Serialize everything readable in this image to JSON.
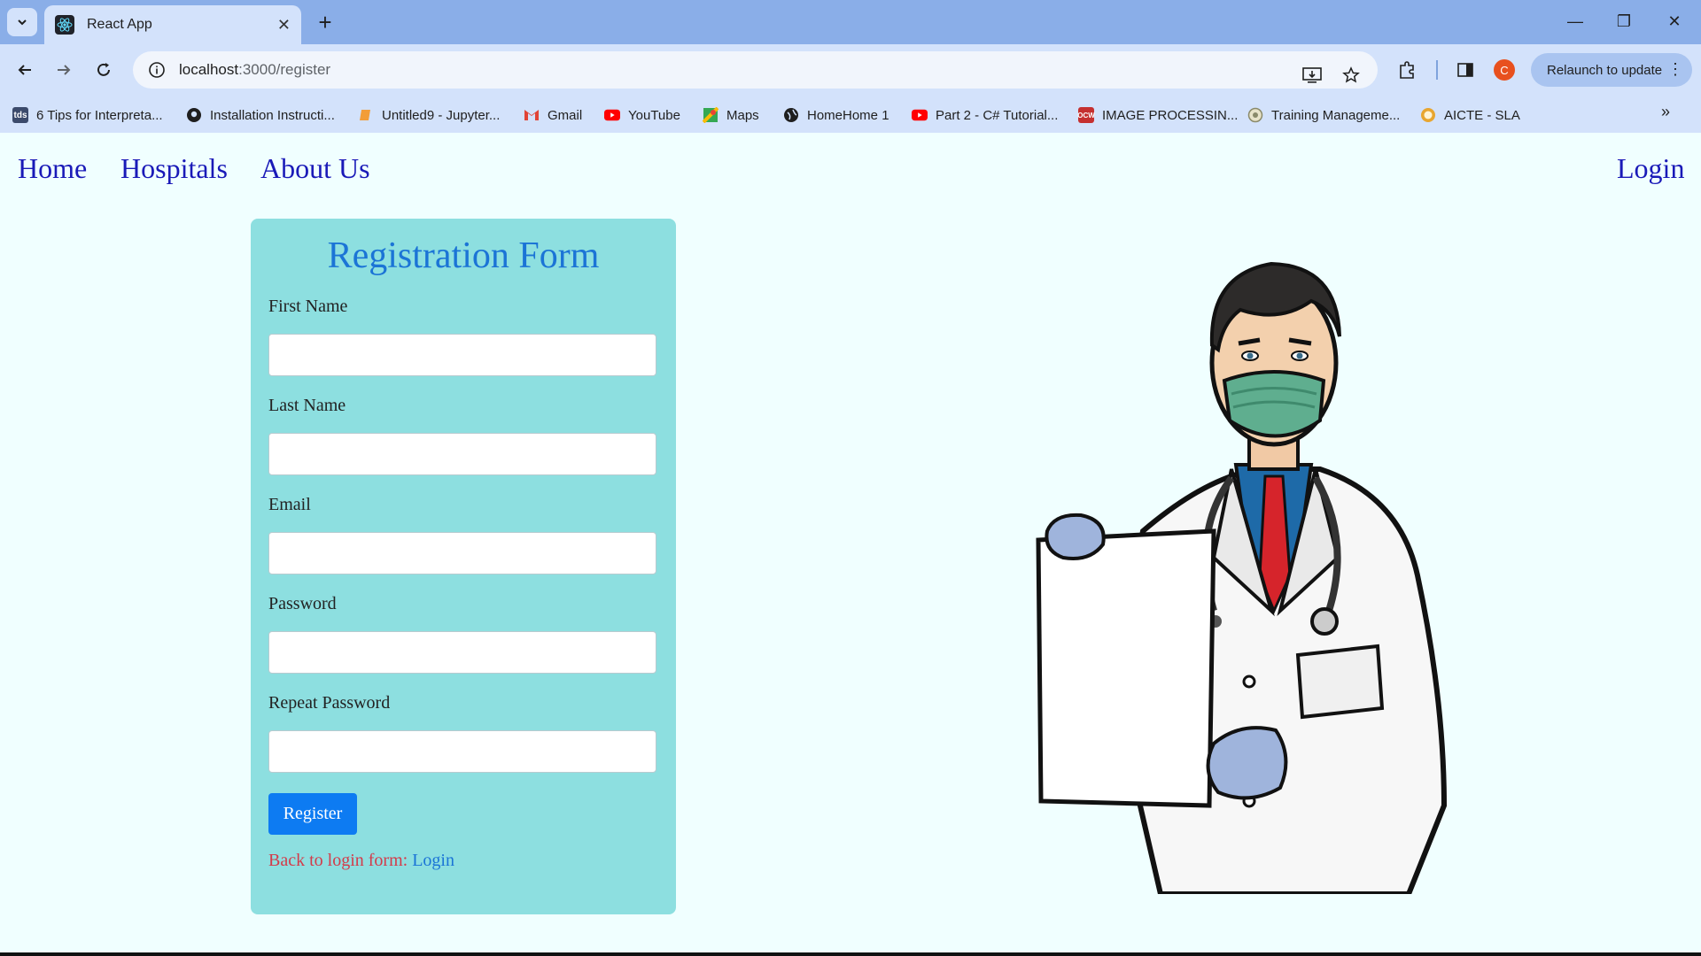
{
  "browser": {
    "tab_title": "React App",
    "url_host": "localhost",
    "url_path": ":3000/register",
    "profile_initial": "C",
    "relaunch_label": "Relaunch to update",
    "bookmarks": [
      {
        "label": "6 Tips for Interpreta...",
        "icon": "tds-icon"
      },
      {
        "label": "Installation Instructi...",
        "icon": "github-icon"
      },
      {
        "label": "Untitled9 - Jupyter...",
        "icon": "jupyter-icon"
      },
      {
        "label": "Gmail",
        "icon": "gmail-icon"
      },
      {
        "label": "YouTube",
        "icon": "youtube-icon"
      },
      {
        "label": "Maps",
        "icon": "maps-icon"
      },
      {
        "label": "HomeHome 1",
        "icon": "globe-icon"
      },
      {
        "label": "Part 2 - C# Tutorial...",
        "icon": "youtube-icon"
      },
      {
        "label": "IMAGE PROCESSIN...",
        "icon": "ocw-icon"
      },
      {
        "label": "Training Manageme...",
        "icon": "training-icon"
      },
      {
        "label": "AICTE - SLA",
        "icon": "aicte-icon"
      }
    ]
  },
  "nav": {
    "home": "Home",
    "hospitals": "Hospitals",
    "about": "About Us",
    "login": "Login"
  },
  "form": {
    "title": "Registration Form",
    "first_name_label": "First Name",
    "last_name_label": "Last Name",
    "email_label": "Email",
    "password_label": "Password",
    "repeat_password_label": "Repeat Password",
    "first_name_value": "",
    "last_name_value": "",
    "email_value": "",
    "password_value": "",
    "repeat_password_value": "",
    "register_button": "Register",
    "back_text": "Back to login form: ",
    "back_link": "Login"
  },
  "colors": {
    "page_bg": "#f0ffff",
    "card_bg": "#8ddfe0",
    "accent": "#0d7bf2",
    "nav_link": "#1a1ab8",
    "back_text": "#d33b4a"
  }
}
